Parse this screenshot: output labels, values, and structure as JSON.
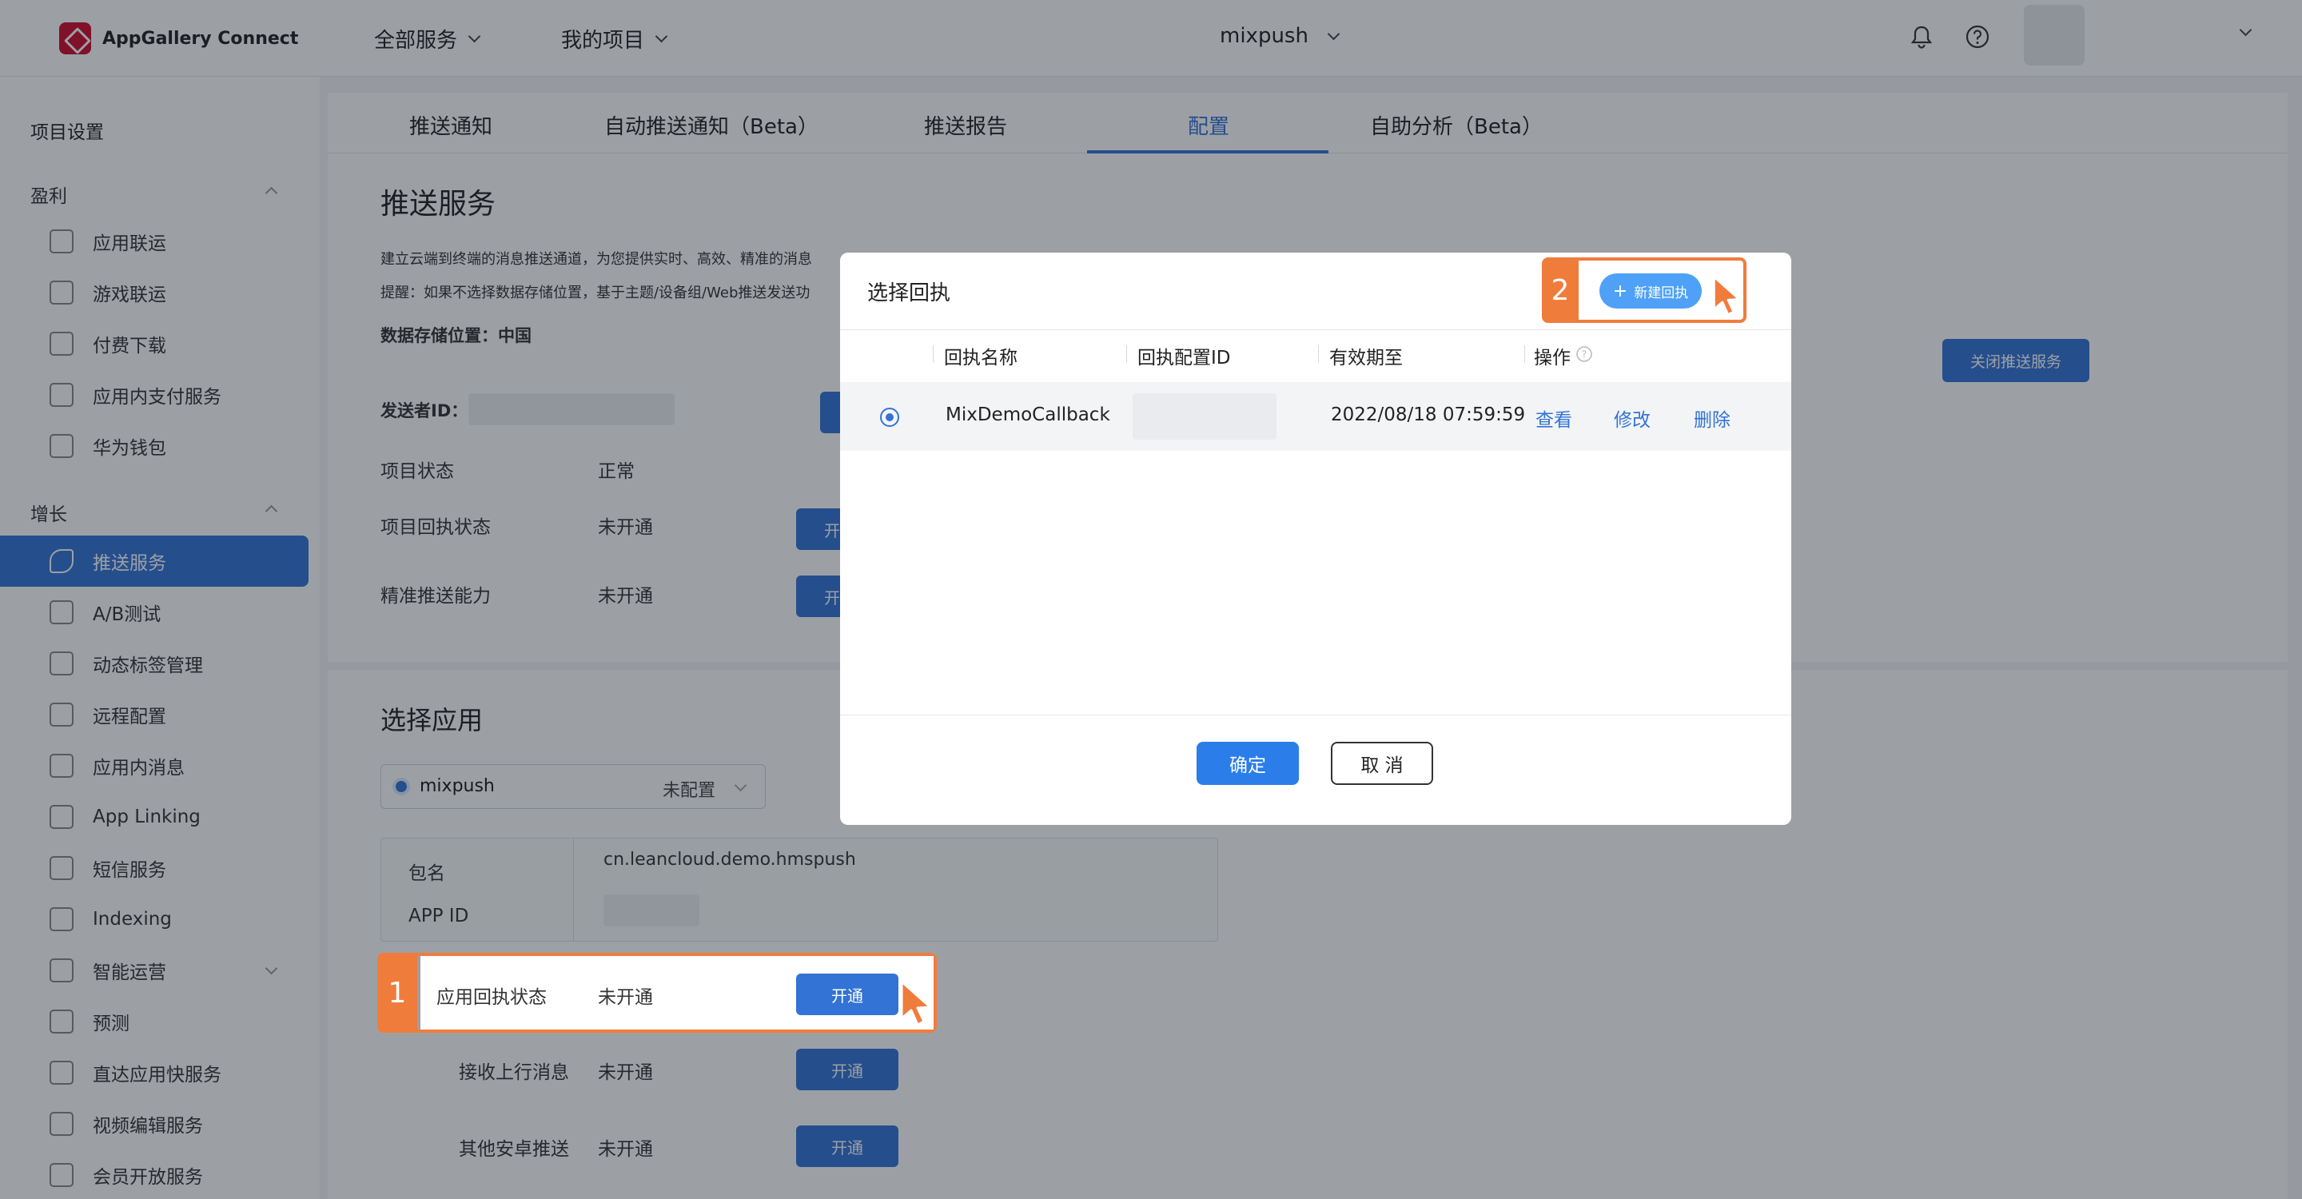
{
  "app": {
    "name": "AppGallery Connect"
  },
  "topbar": {
    "nav_all_services": "全部服务",
    "nav_my_projects": "我的项目",
    "project_name": "mixpush"
  },
  "sidebar": {
    "project_settings": "项目设置",
    "group_monetize": "盈利",
    "monetize_items": [
      "应用联运",
      "游戏联运",
      "付费下载",
      "应用内支付服务",
      "华为钱包"
    ],
    "group_grow": "增长",
    "grow_items": [
      "推送服务",
      "A/B测试",
      "动态标签管理",
      "远程配置",
      "应用内消息",
      "App Linking",
      "短信服务",
      "Indexing",
      "智能运营",
      "预测",
      "直达应用快服务",
      "视频编辑服务",
      "会员开放服务"
    ],
    "active_item": "推送服务"
  },
  "tabs": [
    "推送通知",
    "自动推送通知（Beta）",
    "推送报告",
    "配置",
    "自助分析（Beta）"
  ],
  "active_tab": "配置",
  "push_service": {
    "title": "推送服务",
    "desc_line1": "建立云端到终端的消息推送通道，为您提供实时、高效、精准的消息",
    "desc_line2": "提醒：如果不选择数据存储位置，基于主题/设备组/Web推送发送功",
    "storage_location": "数据存储位置：中国",
    "sender_id_label": "发送者ID：",
    "project_status_label": "项目状态",
    "project_status_value": "正常",
    "callback_status_label": "项目回执状态",
    "callback_status_value": "未开通",
    "precise_push_label": "精准推送能力",
    "precise_push_value": "未开通",
    "close_button": "关闭推送服务",
    "enable_button": "开"
  },
  "select_app": {
    "title": "选择应用",
    "app_name": "mixpush",
    "app_config_status": "未配置",
    "package_label": "包名",
    "package_value": "cn.leancloud.demo.hmspush",
    "appid_label": "APP ID",
    "rows": [
      {
        "label": "应用回执状态",
        "value": "未开通",
        "button": "开通"
      },
      {
        "label": "接收上行消息",
        "value": "未开通",
        "button": "开通"
      },
      {
        "label": "其他安卓推送",
        "value": "未开通",
        "button": "开通"
      }
    ]
  },
  "annotations": {
    "step1": "1",
    "step2": "2",
    "highlight_color": "#f07c3c"
  },
  "modal": {
    "title": "选择回执",
    "new_button": "新建回执",
    "columns": [
      "回执名称",
      "回执配置ID",
      "有效期至",
      "操作"
    ],
    "row": {
      "name": "MixDemoCallback",
      "expires": "2022/08/18 07:59:59",
      "actions": [
        "查看",
        "修改",
        "删除"
      ]
    },
    "ok_button": "确定",
    "cancel_button": "取 消"
  },
  "colors": {
    "accent": "#3273d5",
    "overlay": "rgba(20,28,40,0.42)"
  }
}
